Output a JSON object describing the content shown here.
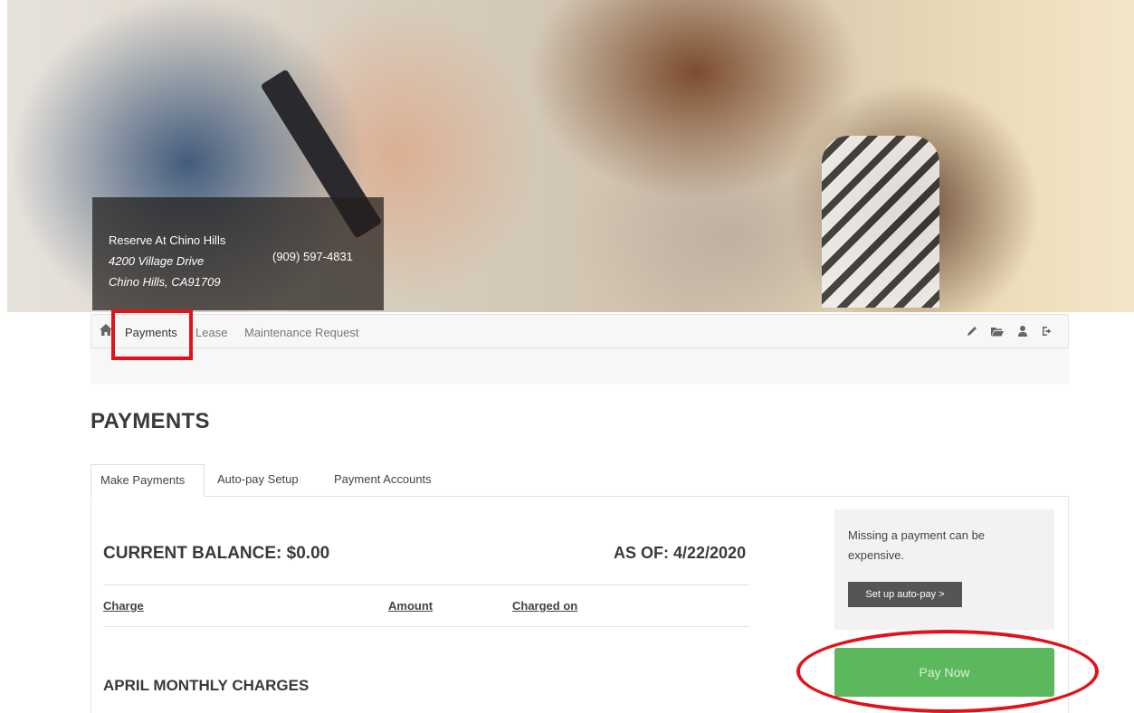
{
  "property": {
    "name": "Reserve At Chino Hills",
    "address_line1": "4200 Village Drive",
    "address_line2": "Chino Hills, CA91709",
    "phone": "(909) 597-4831"
  },
  "nav": {
    "home_icon": "home-icon",
    "items": [
      {
        "label": "Payments",
        "active": true
      },
      {
        "label": "Lease",
        "active": false
      },
      {
        "label": "Maintenance Request",
        "active": false
      }
    ],
    "tools": [
      "pencil-icon",
      "folder-open-icon",
      "user-icon",
      "sign-out-icon"
    ]
  },
  "page": {
    "title": "PAYMENTS"
  },
  "tabs": [
    {
      "label": "Make Payments",
      "active": true
    },
    {
      "label": "Auto-pay Setup",
      "active": false
    },
    {
      "label": "Payment Accounts",
      "active": false
    }
  ],
  "balance": {
    "title": "CURRENT BALANCE: $0.00",
    "as_of": "AS OF: 4/22/2020",
    "columns": [
      "Charge",
      "Amount",
      "Charged on"
    ],
    "section": "APRIL MONTHLY CHARGES"
  },
  "side_panel": {
    "message": "Missing a payment can be expensive.",
    "autopay_label": "Set up auto-pay >",
    "pay_now_label": "Pay Now"
  },
  "colors": {
    "highlight": "#e0131b",
    "pay_now": "#5cb85c",
    "autopay_button": "#555555"
  }
}
